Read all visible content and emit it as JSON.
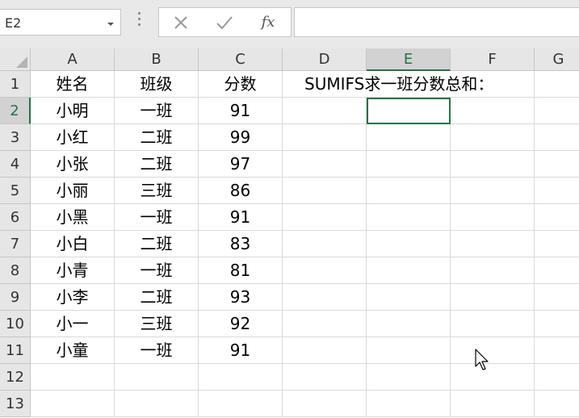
{
  "formula_bar": {
    "name_box": "E2",
    "cancel_icon": "close-icon",
    "enter_icon": "check-icon",
    "fx_label": "fx",
    "formula": ""
  },
  "columns": [
    "A",
    "B",
    "C",
    "D",
    "E",
    "F",
    "G"
  ],
  "rows": [
    "1",
    "2",
    "3",
    "4",
    "5",
    "6",
    "7",
    "8",
    "9",
    "10",
    "11",
    "12",
    "13"
  ],
  "selected_cell": "E2",
  "cells": {
    "A1": "姓名",
    "B1": "班级",
    "C1": "分数",
    "D1": "SUMIFS求一班分数总和：",
    "A2": "小明",
    "B2": "一班",
    "C2": "91",
    "A3": "小红",
    "B3": "二班",
    "C3": "99",
    "A4": "小张",
    "B4": "二班",
    "C4": "97",
    "A5": "小丽",
    "B5": "三班",
    "C5": "86",
    "A6": "小黑",
    "B6": "一班",
    "C6": "91",
    "A7": "小白",
    "B7": "二班",
    "C7": "83",
    "A8": "小青",
    "B8": "一班",
    "C8": "81",
    "A9": "小李",
    "B9": "二班",
    "C9": "93",
    "A10": "小一",
    "B10": "三班",
    "C10": "92",
    "A11": "小童",
    "B11": "一班",
    "C11": "91"
  },
  "colors": {
    "accent": "#217346",
    "header_bg": "#e6e6e6",
    "grid_line": "#dadada"
  }
}
